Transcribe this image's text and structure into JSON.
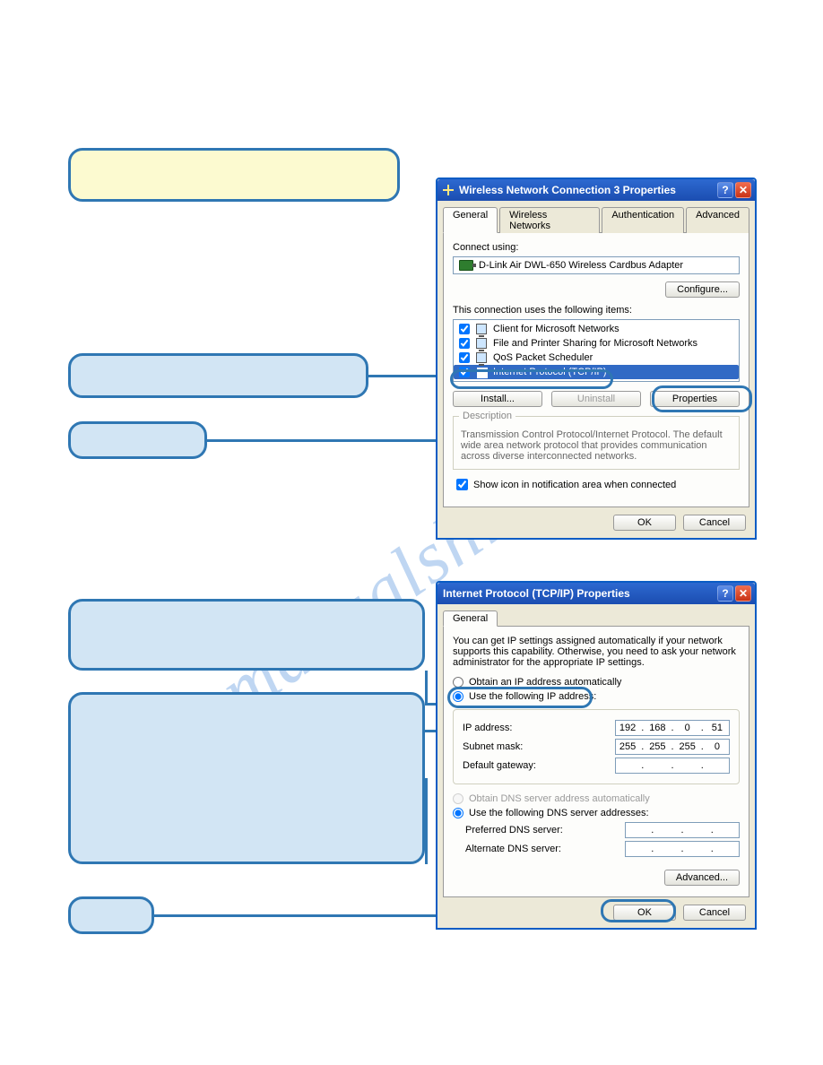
{
  "watermark": "manualshive.com",
  "callouts": {
    "c1": "",
    "c2": "",
    "c3": "",
    "c4": "",
    "c5": "",
    "c6": ""
  },
  "dialog1": {
    "title": "Wireless Network Connection 3 Properties",
    "tabs": [
      "General",
      "Wireless Networks",
      "Authentication",
      "Advanced"
    ],
    "connect_using_label": "Connect using:",
    "adapter": "D-Link Air DWL-650 Wireless Cardbus Adapter",
    "configure_btn": "Configure...",
    "items_label": "This connection uses the following items:",
    "items": [
      {
        "label": "Client for Microsoft Networks",
        "checked": true
      },
      {
        "label": "File and Printer Sharing for Microsoft Networks",
        "checked": true
      },
      {
        "label": "QoS Packet Scheduler",
        "checked": true
      },
      {
        "label": "Internet Protocol (TCP/IP)",
        "checked": true,
        "selected": true
      }
    ],
    "install_btn": "Install...",
    "uninstall_btn": "Uninstall",
    "properties_btn": "Properties",
    "desc_legend": "Description",
    "desc_text": "Transmission Control Protocol/Internet Protocol. The default wide area network protocol that provides communication across diverse interconnected networks.",
    "show_icon": "Show icon in notification area when connected",
    "ok": "OK",
    "cancel": "Cancel"
  },
  "dialog2": {
    "title": "Internet Protocol (TCP/IP) Properties",
    "tab": "General",
    "intro": "You can get IP settings assigned automatically if your network supports this capability. Otherwise, you need to ask your network administrator for the appropriate IP settings.",
    "r_auto": "Obtain an IP address automatically",
    "r_manual": "Use the following IP address:",
    "ip_label": "IP address:",
    "subnet_label": "Subnet mask:",
    "gateway_label": "Default gateway:",
    "ip": [
      "192",
      "168",
      "0",
      "51"
    ],
    "subnet": [
      "255",
      "255",
      "255",
      "0"
    ],
    "gateway": [
      "",
      "",
      "",
      ""
    ],
    "r_dns_auto": "Obtain DNS server address automatically",
    "r_dns_manual": "Use the following DNS server addresses:",
    "dns_pref_label": "Preferred DNS server:",
    "dns_alt_label": "Alternate DNS server:",
    "dns_pref": [
      "",
      "",
      "",
      ""
    ],
    "dns_alt": [
      "",
      "",
      "",
      ""
    ],
    "advanced_btn": "Advanced...",
    "ok": "OK",
    "cancel": "Cancel"
  }
}
